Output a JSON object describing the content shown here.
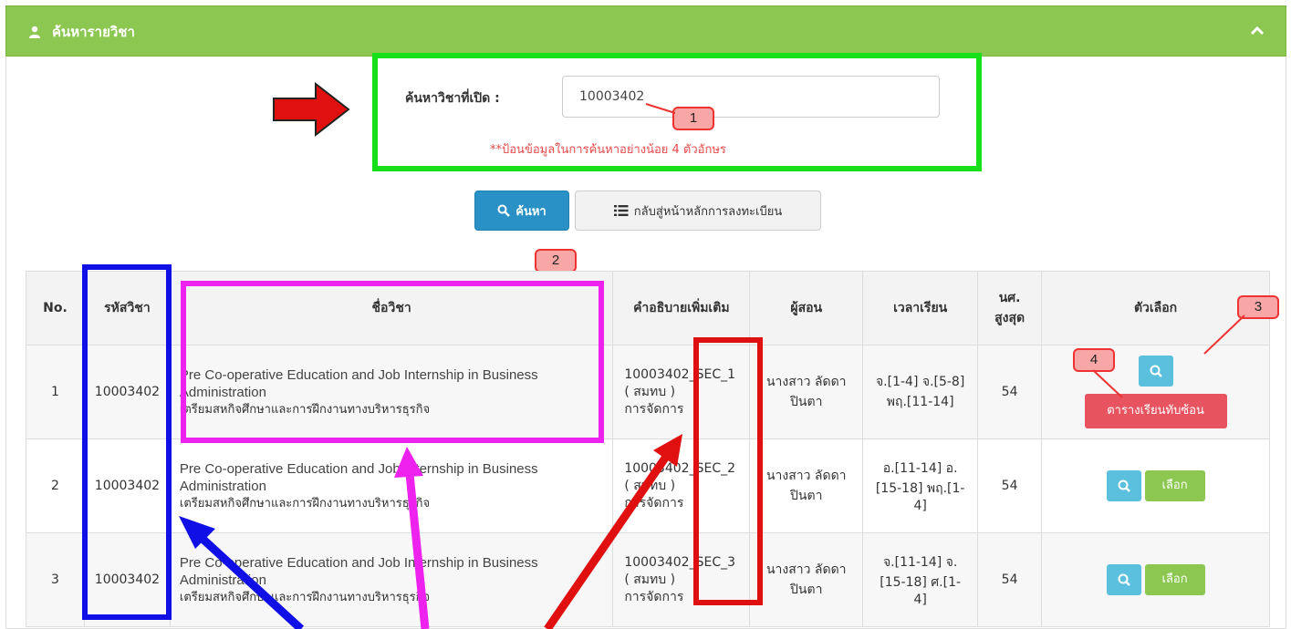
{
  "header": {
    "title": "ค้นหารายวิชา"
  },
  "search": {
    "label": "ค้นหาวิชาที่เปิด :",
    "value": "10003402",
    "hint": "**ป้อนข้อมูลในการค้นหาอย่างน้อย 4 ตัวอักษร"
  },
  "buttons": {
    "search": "ค้นหา",
    "back": "กลับสู่หน้าหลักการลงทะเบียน"
  },
  "markers": [
    "1",
    "2",
    "3",
    "4"
  ],
  "table": {
    "headers": [
      "No.",
      "รหัสวิชา",
      "ชื่อวิชา",
      "คำอธิบายเพิ่มเติม",
      "ผู้สอน",
      "เวลาเรียน",
      "นศ. สูงสุด",
      "ตัวเลือก"
    ],
    "rows": [
      {
        "no": "1",
        "code": "10003402",
        "name_en": "Pre Co-operative Education and Job Internship in Business Administration",
        "name_th": "เตรียมสหกิจศึกษาและการฝึกงานทางบริหารธุรกิจ",
        "sec": "10003402_SEC_1",
        "desc2": "( สมทบ )",
        "desc3": "การจัดการ",
        "teacher": "นางสาว ลัดดา ปินตา",
        "time": "จ.[1-4] จ.[5-8] พฤ.[11-14]",
        "max": "54",
        "conflict": "ตารางเรียนทับซ้อน"
      },
      {
        "no": "2",
        "code": "10003402",
        "name_en": "Pre Co-operative Education and Job Internship in Business Administration",
        "name_th": "เตรียมสหกิจศึกษาและการฝึกงานทางบริหารธุรกิจ",
        "sec": "10003402_SEC_2",
        "desc2": "( สมทบ )",
        "desc3": "การจัดการ",
        "teacher": "นางสาว ลัดดา ปินตา",
        "time": "อ.[11-14] อ.[15-18] พฤ.[1-4]",
        "max": "54",
        "pick": "เลือก"
      },
      {
        "no": "3",
        "code": "10003402",
        "name_en": "Pre Co-operative Education and Job Internship in Business Administration",
        "name_th": "เตรียมสหกิจศึกษาและการฝึกงานทางบริหารธุรกิจ",
        "sec": "10003402_SEC_3",
        "desc2": "( สมทบ )",
        "desc3": "การจัดการ",
        "teacher": "นางสาว ลัดดา ปินตา",
        "time": "จ.[11-14] จ.[15-18] ศ.[1-4]",
        "max": "54",
        "pick": "เลือก"
      }
    ]
  },
  "colors": {
    "header_green": "#8cc751",
    "search_blue": "#2a91c6",
    "conflict_red": "#e7535f",
    "view_cyan": "#5bc0de"
  }
}
